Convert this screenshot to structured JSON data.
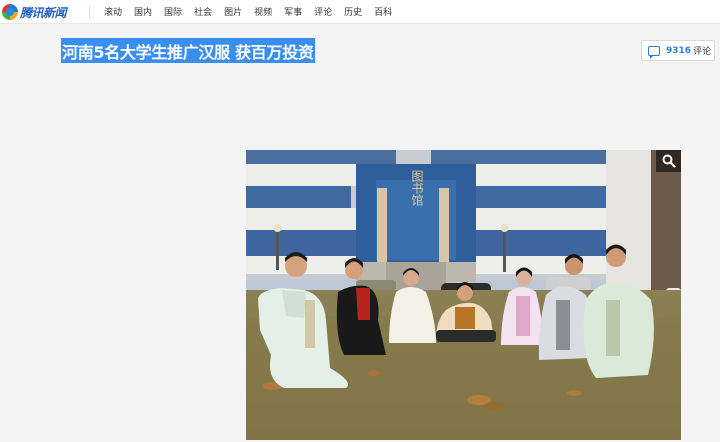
{
  "header": {
    "logo_text": "腾讯新闻",
    "nav": [
      "滚动",
      "国内",
      "国际",
      "社会",
      "图片",
      "视频",
      "军事",
      "评论",
      "历史",
      "百科"
    ]
  },
  "article": {
    "title": "河南5名大学生推广汉服 获百万投资"
  },
  "comments": {
    "count": "9316",
    "label": "评论"
  },
  "image": {
    "building_sign": "图书馆"
  }
}
